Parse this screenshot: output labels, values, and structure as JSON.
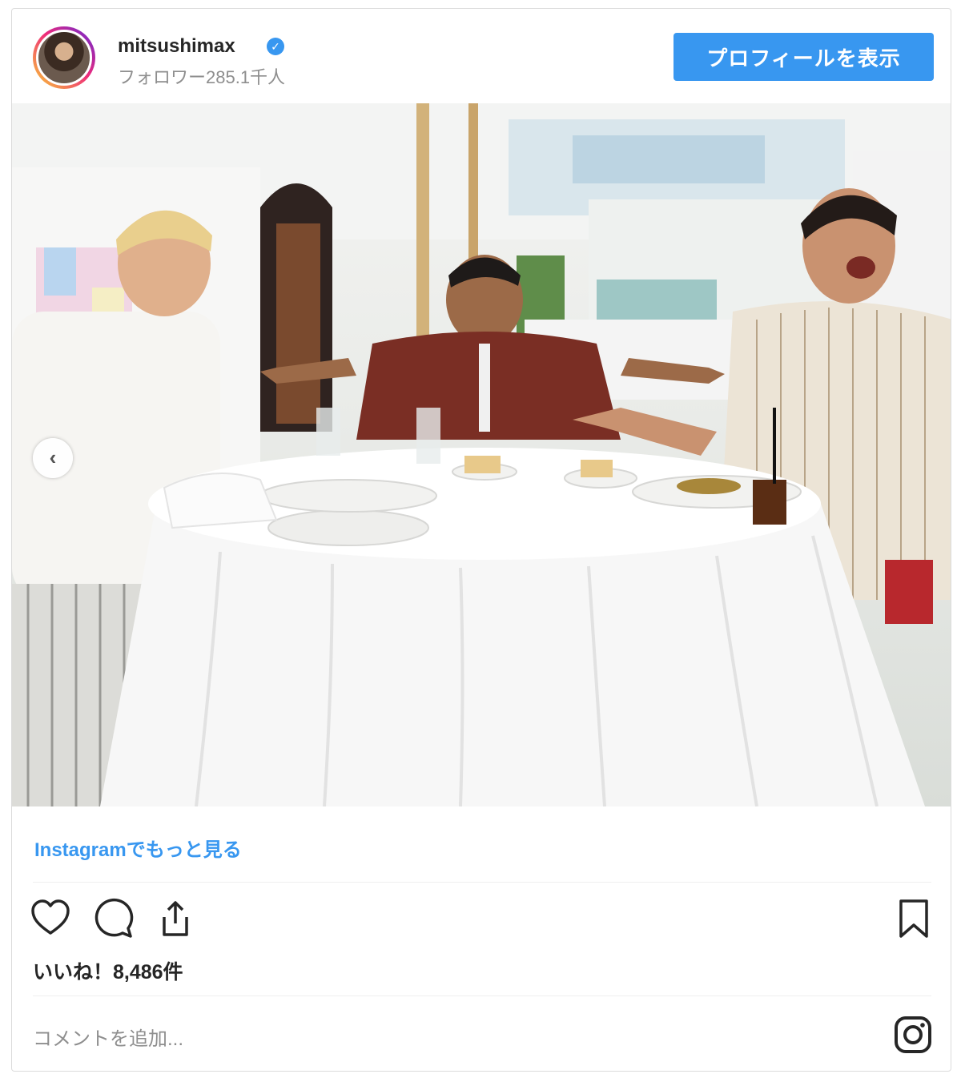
{
  "post": {
    "username": "mitsushimax",
    "verified_icon": "verified-badge-icon",
    "followers": "フォロワー285.1千人",
    "profile_button": "プロフィールを表示",
    "more_link": "Instagramでもっと見る",
    "likes": "いいね！8,486件",
    "comment_placeholder": "コメントを追加...",
    "carousel": {
      "count": 2,
      "active_index": 1
    },
    "icons": [
      "heart-icon",
      "comment-icon",
      "share-icon",
      "bookmark-icon",
      "instagram-icon",
      "chevron-left-icon"
    ]
  },
  "colors": {
    "accent": "#3897f0",
    "border": "#dbdbdb",
    "text": "#262626",
    "muted": "#8e8e8e"
  }
}
